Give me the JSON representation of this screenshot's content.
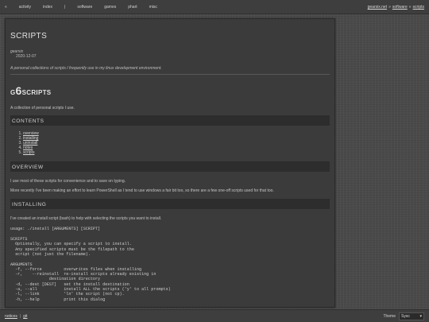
{
  "topnav": {
    "home_symbol": "«",
    "items": [
      "activity",
      "index",
      "|",
      "software",
      "games",
      "phart",
      "misc"
    ],
    "breadcrumb": [
      "gearsix.net",
      "software",
      "scripts"
    ],
    "breadcrumb_sep": "»"
  },
  "header": {
    "title": "scripts",
    "author": "gearsix",
    "date": "2020-12-07",
    "description": "A personal collections of scripts I frequently use in my linux development environment."
  },
  "article": {
    "title_prefix": "g",
    "title_digit": "6",
    "title_rest": "scripts",
    "intro": "A collection of personal scripts I use.",
    "contents_heading": "contents",
    "toc": [
      "overview",
      "installing",
      "uninstall",
      "notes",
      "scripts"
    ],
    "overview_heading": "overview",
    "overview_p1": "I use most of these scripts for convenience and to save on typing.",
    "overview_p2": "More recently I've been making an effort to learn PowerShell as I tend to use windows a fair bit too, so there are a few one-off scripts used for that too.",
    "installing_heading": "installing",
    "installing_p1": "I've created an install script (bash) to help with selecting the scripts you want to install.",
    "usage_code": "usage: ./install [ARGUMENTS] [SCRIPT]\n\nSCRIPTS\n  Optionally, you can specify a script to install.\n  Any specified scripts must be the filepath to the\n  script (not just the filename).\n\nARGUMENTS\n  -f, --force         overwrites files when installing\n  -r,    --reinstall  re-install scripts already existing in\n                destination directory\n  -d, --dest [DEST]   set the install destination\n  -a, --all           install ALL the scripts ('y' to all prompts)\n  -l, --link          'ln' the script (not cp).\n  -h, --help          print this dialog"
  },
  "footer": {
    "links": [
      "notices",
      "git"
    ],
    "theme_label": "Theme",
    "theme_value": "Sysc"
  }
}
